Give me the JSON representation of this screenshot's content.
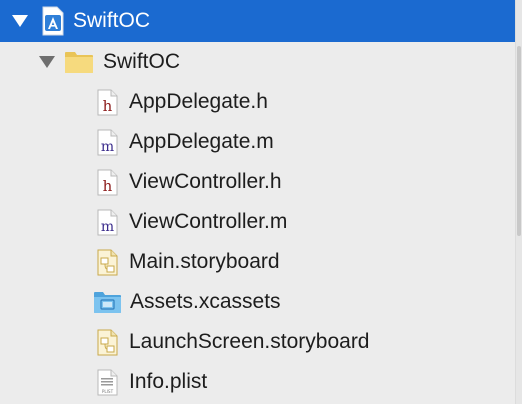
{
  "tree": {
    "project": {
      "label": "SwiftOC",
      "icon": "xcode-project-icon",
      "expanded": true,
      "selected": true
    },
    "group": {
      "label": "SwiftOC",
      "icon": "folder-icon",
      "expanded": true
    },
    "files": [
      {
        "label": "AppDelegate.h",
        "icon": "header-file-icon",
        "glyph": "h"
      },
      {
        "label": "AppDelegate.m",
        "icon": "objc-source-file-icon",
        "glyph": "m"
      },
      {
        "label": "ViewController.h",
        "icon": "header-file-icon",
        "glyph": "h"
      },
      {
        "label": "ViewController.m",
        "icon": "objc-source-file-icon",
        "glyph": "m"
      },
      {
        "label": "Main.storyboard",
        "icon": "storyboard-icon"
      },
      {
        "label": "Assets.xcassets",
        "icon": "asset-catalog-folder-icon"
      },
      {
        "label": "LaunchScreen.storyboard",
        "icon": "storyboard-icon"
      },
      {
        "label": "Info.plist",
        "icon": "plist-file-icon",
        "glyph": "PLIST"
      }
    ]
  },
  "colors": {
    "selection": "#1b6ad0",
    "header_glyph": "#8b1a1a",
    "source_glyph": "#3b2c8c",
    "folder": "#f3d57a",
    "asset_folder": "#6bb8e8"
  }
}
